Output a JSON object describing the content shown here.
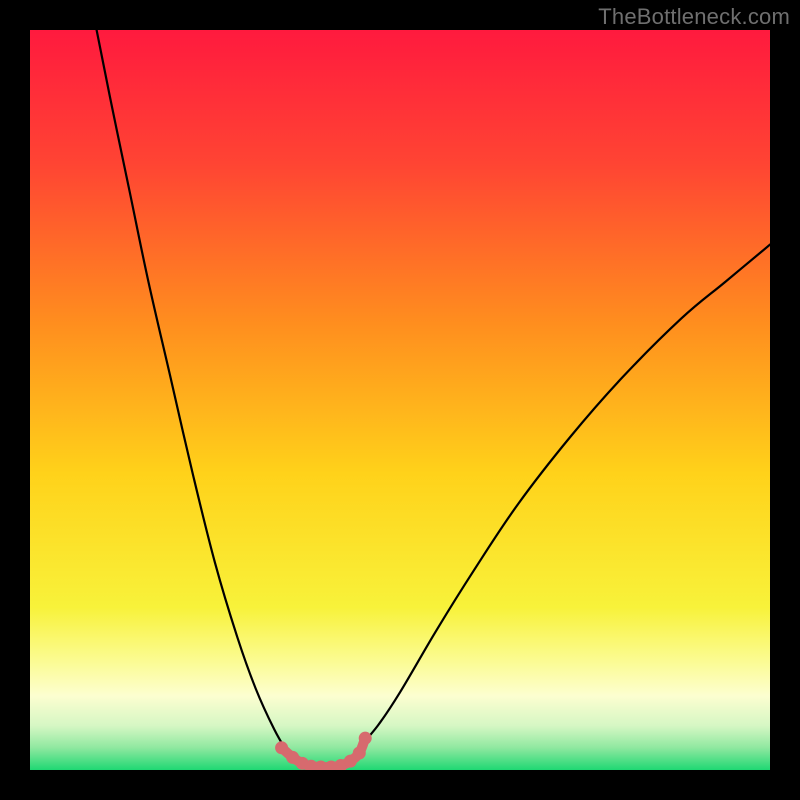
{
  "watermark": "TheBottleneck.com",
  "chart_data": {
    "type": "line",
    "title": "",
    "xlabel": "",
    "ylabel": "",
    "xlim": [
      0,
      100
    ],
    "ylim": [
      0,
      100
    ],
    "grid": false,
    "legend": false,
    "background_gradient_stops": [
      {
        "offset": 0.0,
        "color": "#ff1a3e"
      },
      {
        "offset": 0.18,
        "color": "#ff4433"
      },
      {
        "offset": 0.4,
        "color": "#ff8f1e"
      },
      {
        "offset": 0.6,
        "color": "#ffd21a"
      },
      {
        "offset": 0.78,
        "color": "#f8f23a"
      },
      {
        "offset": 0.85,
        "color": "#fbfb8f"
      },
      {
        "offset": 0.9,
        "color": "#fcfed0"
      },
      {
        "offset": 0.94,
        "color": "#d6f7c4"
      },
      {
        "offset": 0.97,
        "color": "#8fe8a0"
      },
      {
        "offset": 1.0,
        "color": "#1fd873"
      }
    ],
    "series": [
      {
        "name": "curve-left",
        "stroke": "#000000",
        "stroke_width": 2.2,
        "x": [
          9.0,
          11.0,
          13.5,
          16.0,
          19.0,
          22.0,
          25.0,
          28.0,
          30.5,
          33.0,
          35.0
        ],
        "y": [
          100.0,
          90.0,
          78.0,
          66.0,
          53.0,
          40.0,
          28.0,
          18.0,
          11.0,
          5.5,
          2.0
        ]
      },
      {
        "name": "curve-right",
        "stroke": "#000000",
        "stroke_width": 2.2,
        "x": [
          44.0,
          47.0,
          50.0,
          55.0,
          60.0,
          66.0,
          73.0,
          80.0,
          88.0,
          94.0,
          100.0
        ],
        "y": [
          2.5,
          6.0,
          10.5,
          19.0,
          27.0,
          36.0,
          45.0,
          53.0,
          61.0,
          66.0,
          71.0
        ]
      },
      {
        "name": "bottom-beads",
        "type": "scatter-line",
        "stroke": "#d76a6e",
        "stroke_width": 10,
        "marker_radius": 6.5,
        "marker_fill": "#d76a6e",
        "x": [
          34.0,
          35.5,
          36.8,
          38.0,
          39.3,
          40.7,
          42.0,
          43.3,
          44.5,
          45.3
        ],
        "y": [
          3.0,
          1.7,
          0.9,
          0.5,
          0.4,
          0.4,
          0.6,
          1.2,
          2.3,
          4.3
        ]
      }
    ]
  }
}
